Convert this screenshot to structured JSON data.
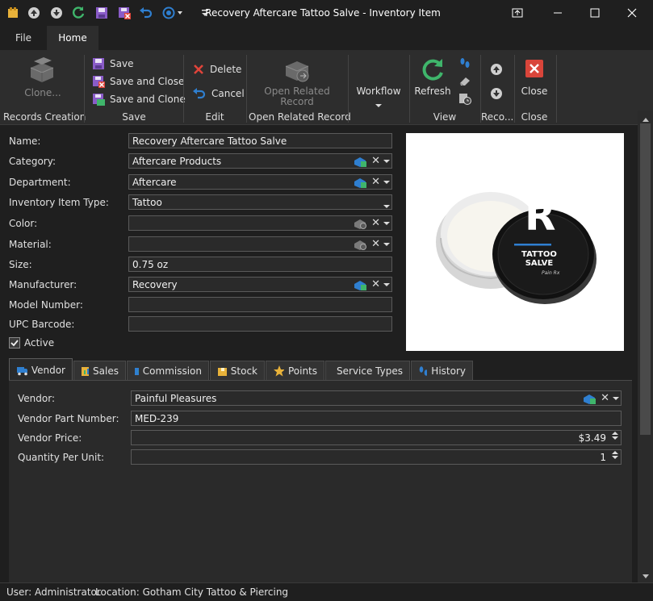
{
  "window": {
    "title": "Recovery Aftercare Tattoo Salve - Inventory Item"
  },
  "ribbon_tabs": {
    "file": "File",
    "home": "Home"
  },
  "ribbon": {
    "clone": "Clone...",
    "records_creation": "Records Creation",
    "save": "Save",
    "save_close": "Save and Close",
    "save_clone": "Save and Clone",
    "save_group": "Save",
    "delete": "Delete",
    "cancel": "Cancel",
    "edit_group": "Edit",
    "open_related_line1": "Open Related",
    "open_related_line2": "Record",
    "open_related_group": "Open Related Record",
    "workflow": "Workflow",
    "refresh": "Refresh",
    "view_group": "View",
    "reco_group": "Reco...",
    "close": "Close",
    "close_group": "Close"
  },
  "form": {
    "name_label": "Name:",
    "name_value": "Recovery Aftercare Tattoo Salve",
    "category_label": "Category:",
    "category_value": "Aftercare Products",
    "department_label": "Department:",
    "department_value": "Aftercare",
    "type_label": "Inventory Item Type:",
    "type_value": "Tattoo",
    "color_label": "Color:",
    "color_value": "",
    "material_label": "Material:",
    "material_value": "",
    "size_label": "Size:",
    "size_value": "0.75 oz",
    "manufacturer_label": "Manufacturer:",
    "manufacturer_value": "Recovery",
    "model_label": "Model Number:",
    "model_value": "",
    "upc_label": "UPC Barcode:",
    "upc_value": "",
    "active_label": "Active",
    "active_checked": true
  },
  "product_image": {
    "brand_letter": "R",
    "lid_line1": "TATTOO",
    "lid_line2": "SALVE",
    "lid_script": "Pain Rx"
  },
  "tabs": [
    "Vendor",
    "Sales",
    "Commission",
    "Stock",
    "Points",
    "Service Types",
    "History"
  ],
  "vendor": {
    "vendor_label": "Vendor:",
    "vendor_value": "Painful Pleasures",
    "part_label": "Vendor Part Number:",
    "part_value": "MED-239",
    "price_label": "Vendor Price:",
    "price_value": "$3.49",
    "qty_label": "Quantity Per Unit:",
    "qty_value": "1"
  },
  "status": {
    "user": "User: Administrator",
    "location": "Location: Gotham City Tattoo & Piercing"
  },
  "colors": {
    "accent_green": "#3fb56b",
    "accent_blue": "#2f7fd0",
    "close_red": "#d9453a",
    "delete_red": "#e0443a",
    "save_purple": "#8a5cc8"
  }
}
